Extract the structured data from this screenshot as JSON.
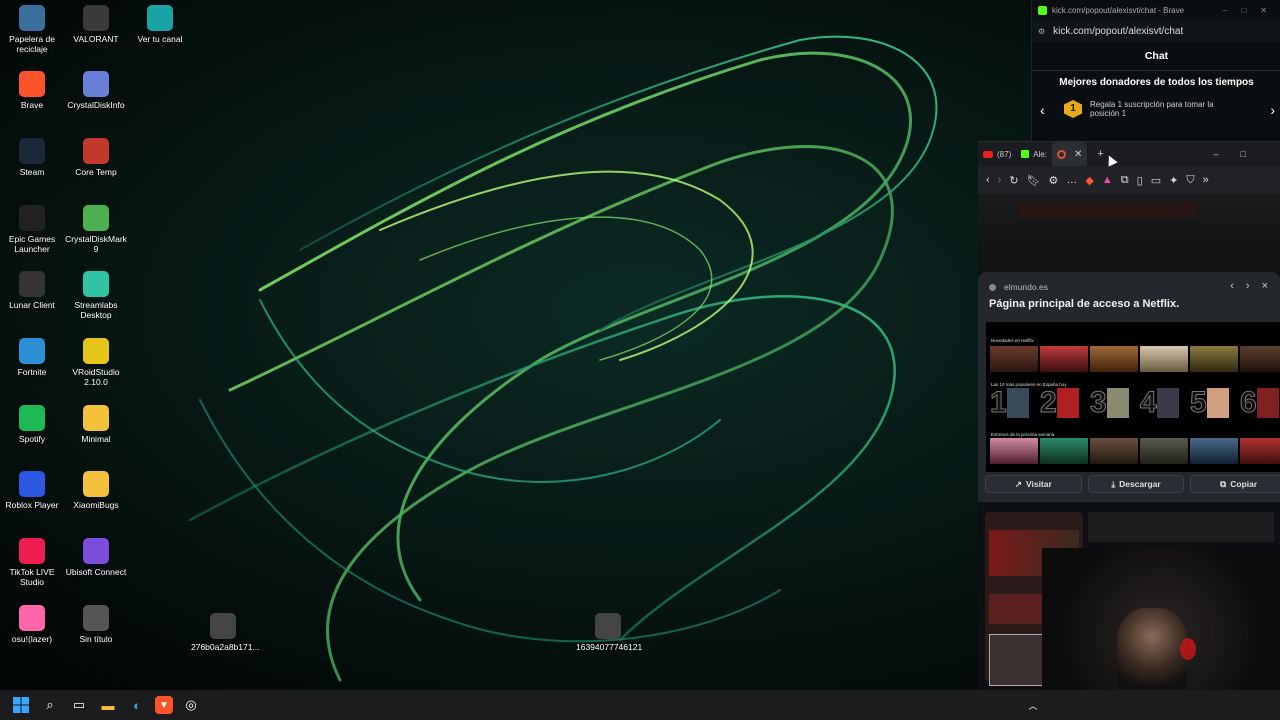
{
  "desktop": {
    "icons": [
      {
        "label": "Papelera de reciclaje",
        "icon": "recycle-bin-icon",
        "color": "#3a6f9c"
      },
      {
        "label": "VALORANT",
        "icon": "valorant-icon",
        "color": "#3a3a3a"
      },
      {
        "label": "Ver tu canal",
        "icon": "edge-icon",
        "color": "#1aa3a3"
      },
      {
        "label": "Brave",
        "icon": "brave-icon",
        "color": "#fb542b"
      },
      {
        "label": "CrystalDiskInfo",
        "icon": "crystaldiskinfo-icon",
        "color": "#6a7fd8"
      },
      {
        "label": "Steam",
        "icon": "steam-icon",
        "color": "#1b2838"
      },
      {
        "label": "Core Temp",
        "icon": "core-temp-icon",
        "color": "#c0392b"
      },
      {
        "label": "Epic Games Launcher",
        "icon": "epic-games-icon",
        "color": "#222222"
      },
      {
        "label": "CrystalDiskMark 9",
        "icon": "crystaldiskmark-icon",
        "color": "#4caf50"
      },
      {
        "label": "Lunar Client",
        "icon": "lunar-client-icon",
        "color": "#333333"
      },
      {
        "label": "Streamlabs Desktop",
        "icon": "streamlabs-icon",
        "color": "#31c3a2"
      },
      {
        "label": "Fortnite",
        "icon": "fortnite-icon",
        "color": "#2d8fd5"
      },
      {
        "label": "VRoidStudio 2.10.0",
        "icon": "vroid-icon",
        "color": "#e6c619"
      },
      {
        "label": "Spotify",
        "icon": "spotify-icon",
        "color": "#1db954"
      },
      {
        "label": "Minimal",
        "icon": "folder-icon",
        "color": "#f3c13a"
      },
      {
        "label": "Roblox Player",
        "icon": "roblox-icon",
        "color": "#2c58e0"
      },
      {
        "label": "XiaomiBugs",
        "icon": "folder-icon",
        "color": "#f3c13a"
      },
      {
        "label": "TikTok LIVE Studio",
        "icon": "tiktok-icon",
        "color": "#ee1d52"
      },
      {
        "label": "Ubisoft Connect",
        "icon": "ubisoft-icon",
        "color": "#7a4ddb"
      },
      {
        "label": "osu!(lazer)",
        "icon": "osu-icon",
        "color": "#ff66aa"
      },
      {
        "label": "Sin título",
        "icon": "image-file-icon",
        "color": "#555555"
      },
      {
        "label": "276b0a2a8b171...",
        "icon": "video-file-icon",
        "color": "#444444"
      },
      {
        "label": "16394077746121",
        "icon": "video-file-icon",
        "color": "#444444"
      }
    ]
  },
  "chat_window": {
    "title": "kick.com/popout/alexisvt/chat - Brave",
    "url": "kick.com/popout/alexisvt/chat",
    "header": "Chat",
    "donors_title": "Mejores donadores de todos los tiempos",
    "rank": "1",
    "donor_text": "Regala 1 suscripción para tomar la posición 1"
  },
  "browser": {
    "tabs": [
      {
        "label": "(87)",
        "icon": "youtube-icon"
      },
      {
        "label": "Ale:",
        "icon": "kick-icon"
      },
      {
        "label": "",
        "icon": "brave-tab-icon"
      }
    ],
    "preview": {
      "site": "elmundo.es",
      "title": "Página principal de acceso a Netflix.",
      "section1": "Novedades en Netflix",
      "section2": "Las 10 más populares en España hoy",
      "section3": "Estrenos de la próxima semana",
      "ranks": [
        "1",
        "2",
        "3",
        "4",
        "5",
        "6"
      ],
      "visit": "Visitar",
      "download": "Descargar",
      "copy": "Copiar"
    }
  },
  "colors": {
    "kick_green": "#53fc18",
    "rank_badge": "#e8a91a"
  }
}
